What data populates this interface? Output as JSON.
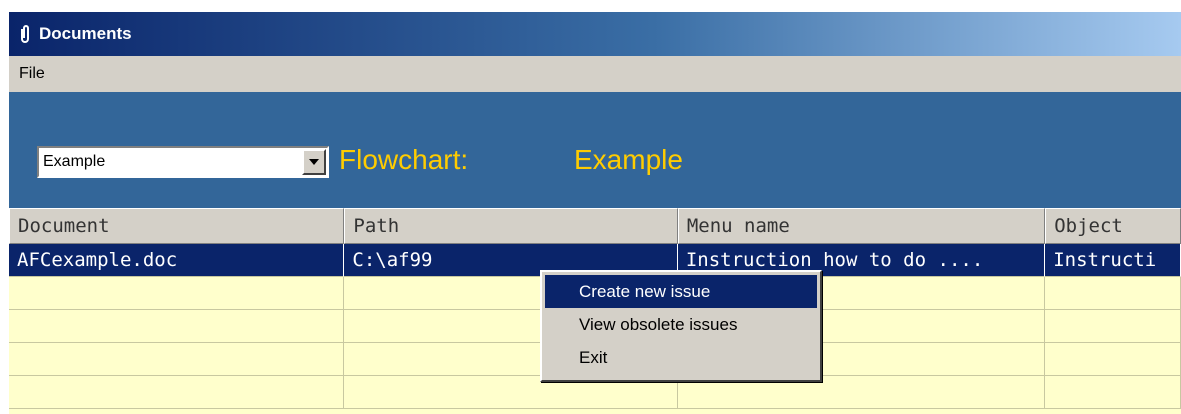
{
  "window": {
    "title": "Documents",
    "icon": "paperclip-icon"
  },
  "menubar": {
    "items": [
      "File"
    ]
  },
  "toolbar": {
    "combo_value": "Example",
    "flowchart_label": "Flowchart:",
    "flowchart_name": "Example"
  },
  "colors": {
    "panel": "#336699",
    "accent_text": "#ffcc00",
    "grid_bg": "#ffffcc",
    "selection": "#0a246a"
  },
  "table": {
    "columns": [
      "Document",
      "Path",
      "Menu name",
      "Object"
    ],
    "rows": [
      [
        "AFCexample.doc",
        "C:\\af99",
        "Instruction how to do ....",
        "Instructi"
      ],
      [
        "",
        "",
        "",
        ""
      ],
      [
        "",
        "",
        "",
        ""
      ],
      [
        "",
        "",
        "",
        ""
      ],
      [
        "",
        "",
        "",
        ""
      ]
    ],
    "selected_row": 0
  },
  "context_menu": {
    "items": [
      "Create new issue",
      "View obsolete issues",
      "Exit"
    ],
    "highlighted": 0
  }
}
